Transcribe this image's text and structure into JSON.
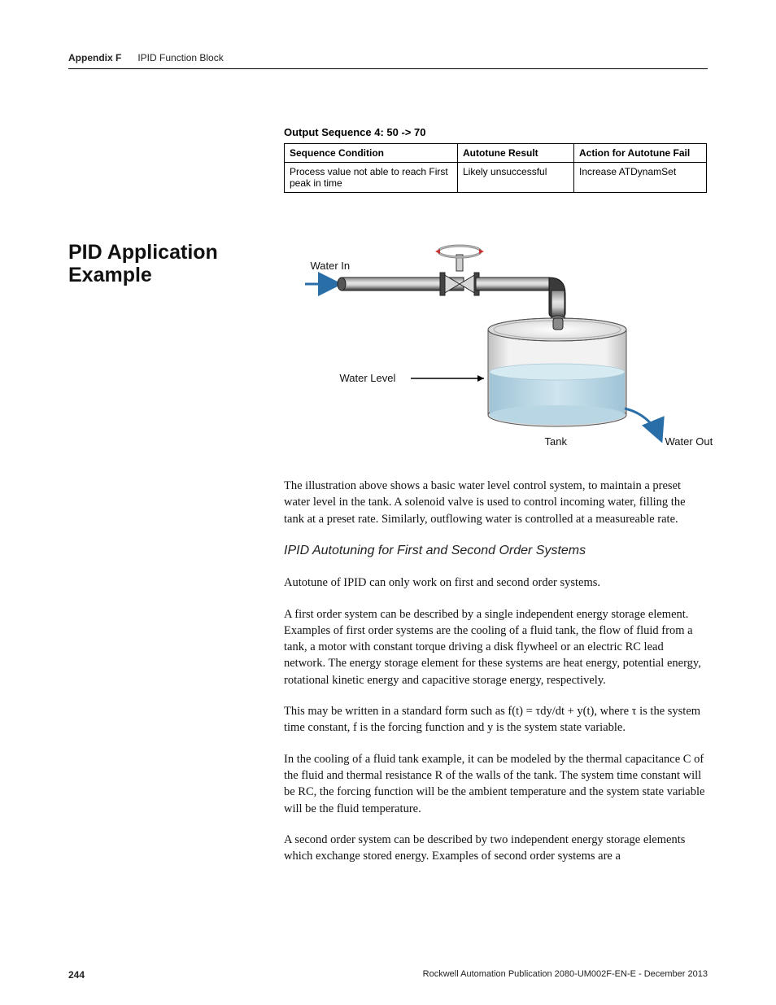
{
  "header": {
    "appendix": "Appendix F",
    "title": "IPID Function Block"
  },
  "table": {
    "caption": "Output Sequence 4: 50 -> 70",
    "headers": [
      "Sequence Condition",
      "Autotune Result",
      "Action for Autotune Fail"
    ],
    "row": {
      "condition": "Process value not able to reach First peak in time",
      "result": "Likely unsuccessful",
      "action": "Increase ATDynamSet"
    }
  },
  "section_heading": "PID Application Example",
  "diagram_labels": {
    "water_in": "Water In",
    "water_level": "Water Level",
    "tank": "Tank",
    "water_out": "Water Out"
  },
  "paragraphs": {
    "p1": "The illustration above shows a basic water level control system, to maintain a preset water level in the tank. A solenoid valve is used to control incoming water, filling the tank at a preset rate. Similarly, outflowing water is controlled at a measureable rate.",
    "sub": "IPID Autotuning for First and Second Order Systems",
    "p2": "Autotune of IPID can only work on first and second order systems.",
    "p3": "A first order system can be described by a single independent energy storage element. Examples of first order systems are the cooling of a fluid tank, the flow of fluid from a tank, a motor with constant torque driving a disk flywheel or an electric RC lead network. The energy storage element for these systems are heat energy, potential energy, rotational kinetic energy and capacitive storage energy, respectively.",
    "p4": "This may be written in a standard form such as f(t) = τdy/dt + y(t), where τ is the system time constant, f is the forcing function and y is the system state variable.",
    "p5": "In the cooling of a fluid tank example, it can be modeled by the thermal capacitance C of the fluid and thermal resistance R of the walls of the tank. The system time constant will be RC, the forcing function will be the ambient temperature and the system state variable will be the fluid temperature.",
    "p6": "A second order system can be described by two independent energy storage elements which exchange stored energy. Examples of second order systems are a"
  },
  "footer": {
    "page": "244",
    "pub": "Rockwell Automation Publication 2080-UM002F-EN-E - December 2013"
  }
}
